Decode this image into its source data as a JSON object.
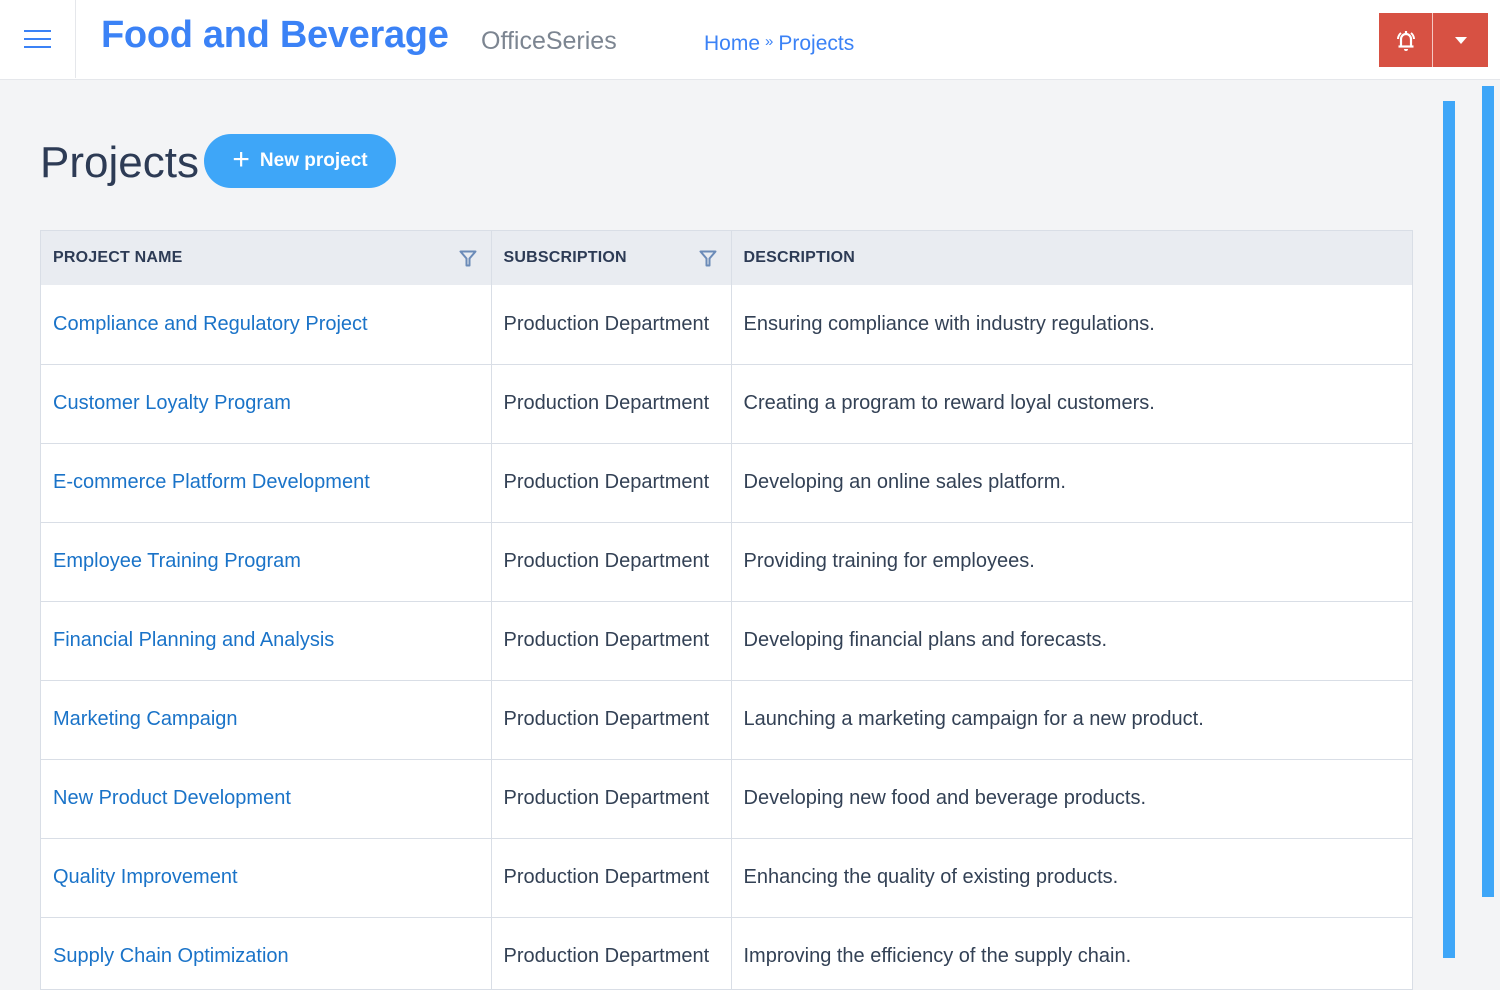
{
  "header": {
    "app_title": "Food and Beverage",
    "app_subtitle": "OfficeSeries",
    "breadcrumb": [
      {
        "label": "Home"
      },
      {
        "label": "Projects"
      }
    ],
    "breadcrumb_separator": "»",
    "icons": {
      "menu": "hamburger-menu-icon",
      "notifications": "bell-ringing-icon",
      "dropdown": "caret-down-icon"
    },
    "colors": {
      "brand": "#3b82f6",
      "alert": "#d75143"
    }
  },
  "page": {
    "title": "Projects",
    "new_button_label": "New project",
    "new_button_icon": "plus-icon",
    "accent": "#3ea6f8"
  },
  "table": {
    "columns": [
      {
        "label": "PROJECT NAME",
        "filterable": true
      },
      {
        "label": "SUBSCRIPTION",
        "filterable": true
      },
      {
        "label": "DESCRIPTION",
        "filterable": false
      }
    ],
    "rows": [
      {
        "name": "Compliance and Regulatory Project",
        "subscription": "Production Department",
        "description": "Ensuring compliance with industry regulations."
      },
      {
        "name": "Customer Loyalty Program",
        "subscription": "Production Department",
        "description": "Creating a program to reward loyal customers."
      },
      {
        "name": "E-commerce Platform Development",
        "subscription": "Production Department",
        "description": "Developing an online sales platform."
      },
      {
        "name": "Employee Training Program",
        "subscription": "Production Department",
        "description": "Providing training for employees."
      },
      {
        "name": "Financial Planning and Analysis",
        "subscription": "Production Department",
        "description": "Developing financial plans and forecasts."
      },
      {
        "name": "Marketing Campaign",
        "subscription": "Production Department",
        "description": "Launching a marketing campaign for a new product."
      },
      {
        "name": "New Product Development",
        "subscription": "Production Department",
        "description": "Developing new food and beverage products."
      },
      {
        "name": "Quality Improvement",
        "subscription": "Production Department",
        "description": "Enhancing the quality of existing products."
      },
      {
        "name": "Supply Chain Optimization",
        "subscription": "Production Department",
        "description": "Improving the efficiency of the supply chain."
      }
    ]
  }
}
